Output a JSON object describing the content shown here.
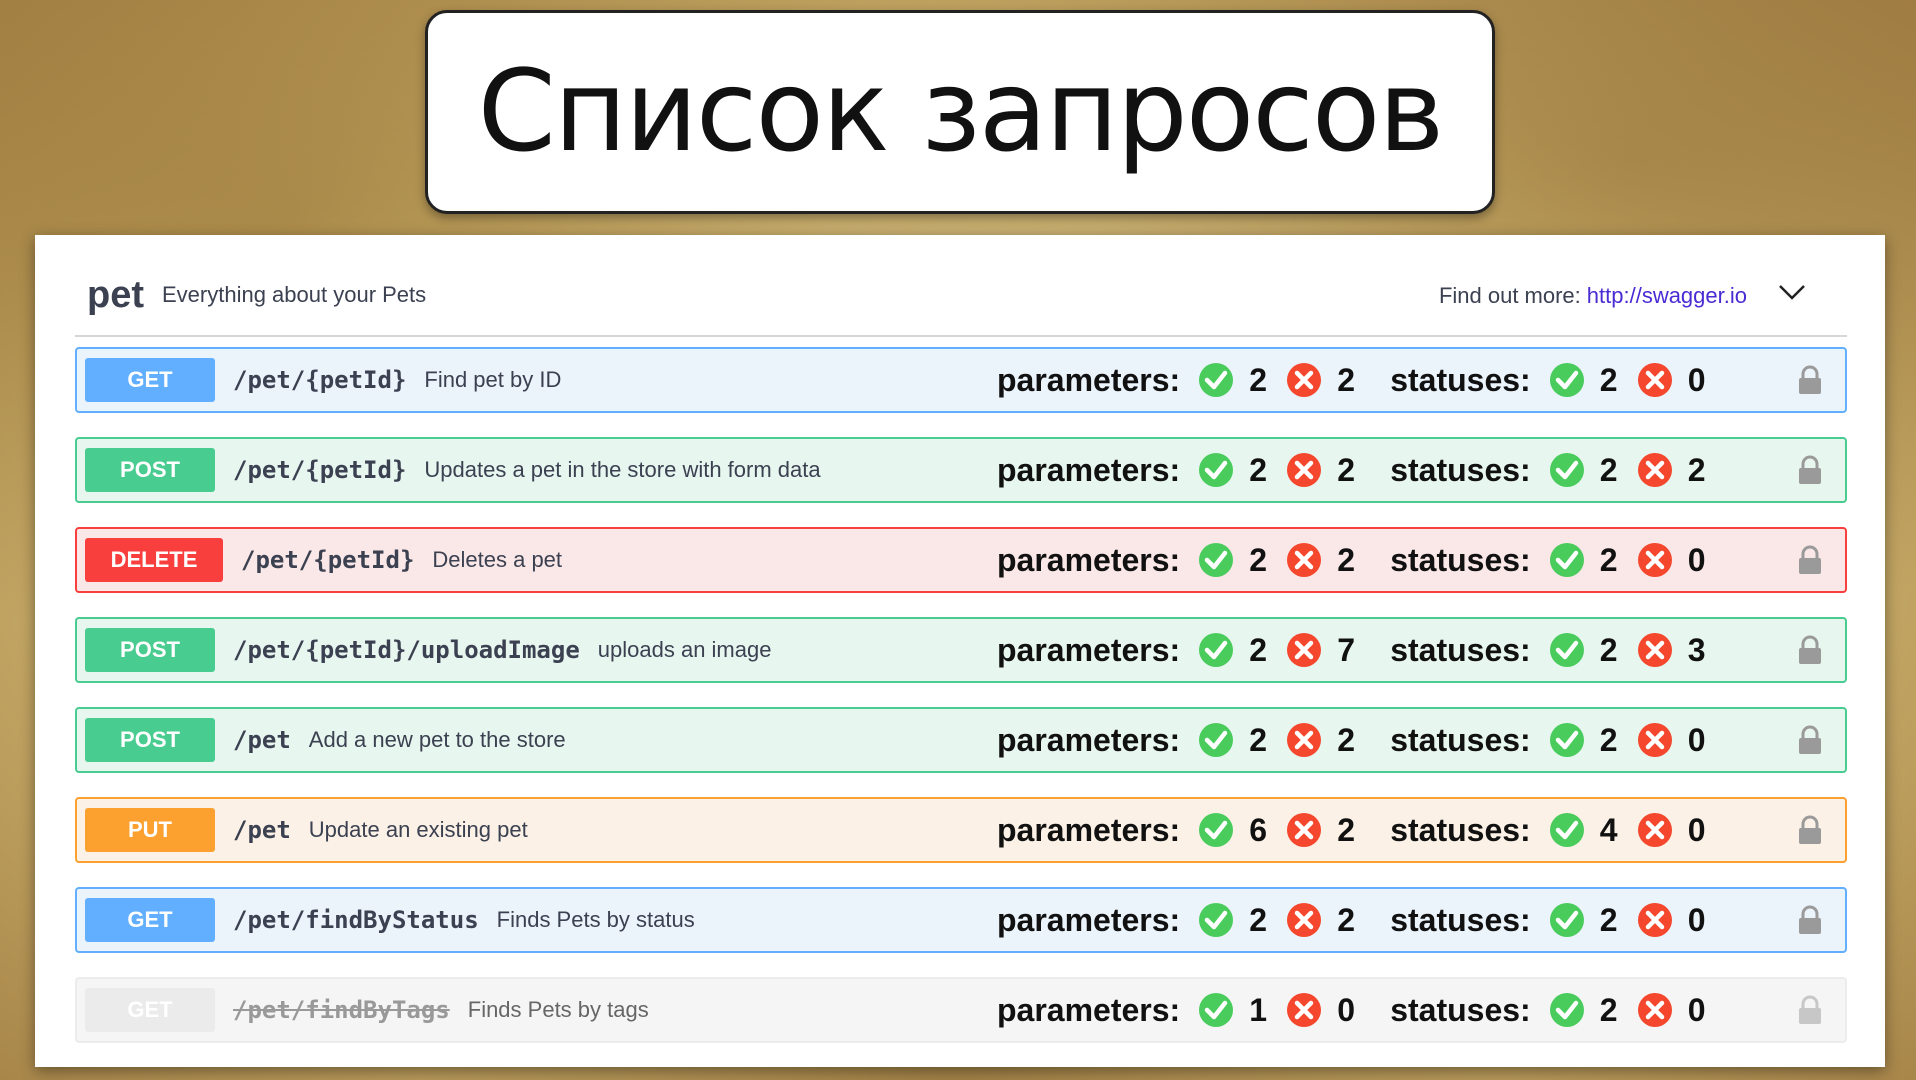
{
  "slide_title": "Список запросов",
  "tag": {
    "name": "pet",
    "description": "Everything about your Pets",
    "find_more_label": "Find out more:",
    "find_more_link": "http://swagger.io"
  },
  "labels": {
    "parameters": "parameters:",
    "statuses": "statuses:"
  },
  "operations": [
    {
      "method": "GET",
      "path": "/pet/{petId}",
      "summary": "Find pet by ID",
      "params_ok": "2",
      "params_fail": "2",
      "status_ok": "2",
      "status_fail": "0"
    },
    {
      "method": "POST",
      "path": "/pet/{petId}",
      "summary": "Updates a pet in the store with form data",
      "params_ok": "2",
      "params_fail": "2",
      "status_ok": "2",
      "status_fail": "2"
    },
    {
      "method": "DELETE",
      "path": "/pet/{petId}",
      "summary": "Deletes a pet",
      "params_ok": "2",
      "params_fail": "2",
      "status_ok": "2",
      "status_fail": "0"
    },
    {
      "method": "POST",
      "path": "/pet/{petId}/uploadImage",
      "summary": "uploads an image",
      "params_ok": "2",
      "params_fail": "7",
      "status_ok": "2",
      "status_fail": "3"
    },
    {
      "method": "POST",
      "path": "/pet",
      "summary": "Add a new pet to the store",
      "params_ok": "2",
      "params_fail": "2",
      "status_ok": "2",
      "status_fail": "0"
    },
    {
      "method": "PUT",
      "path": "/pet",
      "summary": "Update an existing pet",
      "params_ok": "6",
      "params_fail": "2",
      "status_ok": "4",
      "status_fail": "0"
    },
    {
      "method": "GET",
      "path": "/pet/findByStatus",
      "summary": "Finds Pets by status",
      "params_ok": "2",
      "params_fail": "2",
      "status_ok": "2",
      "status_fail": "0"
    },
    {
      "method": "GET",
      "path": "/pet/findByTags",
      "summary": "Finds Pets by tags",
      "params_ok": "1",
      "params_fail": "0",
      "status_ok": "2",
      "status_fail": "0",
      "deprecated": true
    }
  ],
  "icons": {
    "ok": "check-circle-icon",
    "fail": "x-circle-icon",
    "lock": "lock-icon",
    "chevron": "chevron-down-icon"
  },
  "colors": {
    "get": "#61affe",
    "post": "#49cc90",
    "delete": "#f93e3e",
    "put": "#fca130",
    "ok": "#49cc5c",
    "fail": "#f4472d",
    "link": "#4a2bd4"
  }
}
